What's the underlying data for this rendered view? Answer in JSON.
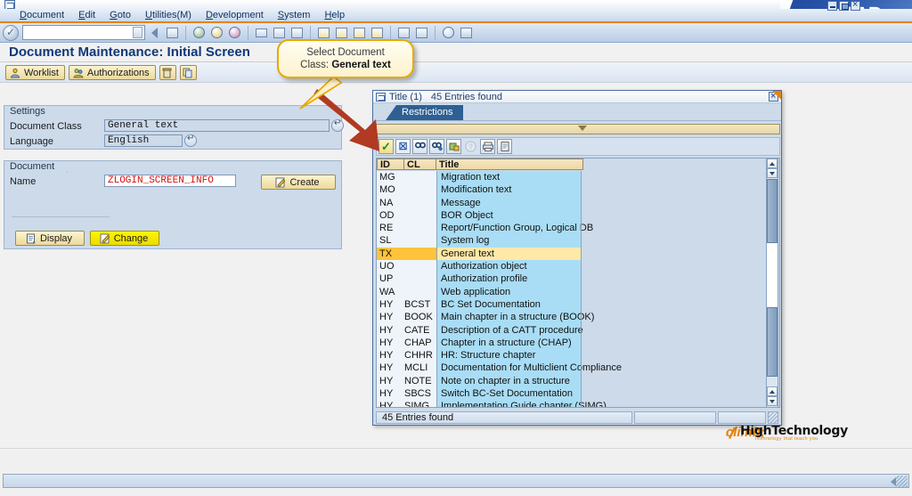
{
  "window": {
    "controls": [
      "minimize",
      "maximize",
      "close"
    ],
    "logo": "SAP"
  },
  "menubar": {
    "items": [
      {
        "label": "Document"
      },
      {
        "label": "Edit"
      },
      {
        "label": "Goto"
      },
      {
        "label": "Utilities(M)"
      },
      {
        "label": "Development"
      },
      {
        "label": "System"
      },
      {
        "label": "Help"
      }
    ]
  },
  "toolbar": {
    "command_value": "",
    "icons": [
      "enter-ok-icon",
      "back-icon",
      "save-icon",
      "back-green-icon",
      "exit-icon",
      "cancel-icon",
      "print-icon",
      "find-icon",
      "find-next-icon",
      "first-page-icon",
      "previous-page-icon",
      "next-page-icon",
      "last-page-icon",
      "new-session-icon",
      "create-shortcut-icon",
      "help-icon",
      "customize-icon"
    ]
  },
  "page": {
    "title": "Document Maintenance: Initial Screen"
  },
  "appbar": {
    "buttons": [
      {
        "label": "Worklist",
        "icon": "worklist-icon"
      },
      {
        "label": "Authorizations",
        "icon": "authorizations-icon"
      }
    ],
    "icon_buttons": [
      "delete-icon",
      "copy-icon"
    ]
  },
  "settings_panel": {
    "title": "Settings",
    "document_class_label": "Document Class",
    "document_class_value": "General text",
    "language_label": "Language",
    "language_value": "English"
  },
  "document_panel": {
    "title": "Document",
    "name_label": "Name",
    "name_value": "ZLOGIN_SCREEN_INFO",
    "create_button": "Create",
    "display_button": "Display",
    "change_button": "Change"
  },
  "callout": {
    "line1": "Select Document",
    "line2_prefix": "Class: ",
    "line2_bold": "General text"
  },
  "dialog": {
    "title": "Title (1)",
    "entries_found": "45 Entries found",
    "tab_label": "Restrictions",
    "toolbar_icons": [
      "copy-selection-icon",
      "cancel-icon",
      "find-icon",
      "find-next-icon",
      "personal-values-icon",
      "help-icon",
      "print-icon",
      "list-icon"
    ],
    "columns": [
      "ID",
      "CL",
      "Title"
    ],
    "status_text": "45 Entries found",
    "rows": [
      {
        "id": "MG",
        "cl": "",
        "title": "Migration text",
        "selected": false
      },
      {
        "id": "MO",
        "cl": "",
        "title": "Modification text",
        "selected": false
      },
      {
        "id": "NA",
        "cl": "",
        "title": "Message",
        "selected": false
      },
      {
        "id": "OD",
        "cl": "",
        "title": "BOR Object",
        "selected": false
      },
      {
        "id": "RE",
        "cl": "",
        "title": "Report/Function Group, Logical DB",
        "selected": false
      },
      {
        "id": "SL",
        "cl": "",
        "title": "System log",
        "selected": false
      },
      {
        "id": "TX",
        "cl": "",
        "title": "General text",
        "selected": true
      },
      {
        "id": "UO",
        "cl": "",
        "title": "Authorization object",
        "selected": false
      },
      {
        "id": "UP",
        "cl": "",
        "title": "Authorization profile",
        "selected": false
      },
      {
        "id": "WA",
        "cl": "",
        "title": "Web application",
        "selected": false
      },
      {
        "id": "HY",
        "cl": "BCST",
        "title": "BC Set Documentation",
        "selected": false
      },
      {
        "id": "HY",
        "cl": "BOOK",
        "title": "Main chapter in a structure (BOOK)",
        "selected": false
      },
      {
        "id": "HY",
        "cl": "CATE",
        "title": "Description of a CATT procedure",
        "selected": false
      },
      {
        "id": "HY",
        "cl": "CHAP",
        "title": "Chapter in a structure (CHAP)",
        "selected": false
      },
      {
        "id": "HY",
        "cl": "CHHR",
        "title": "HR: Structure chapter",
        "selected": false
      },
      {
        "id": "HY",
        "cl": "MCLI",
        "title": "Documentation for Multiclient Compliance",
        "selected": false
      },
      {
        "id": "HY",
        "cl": "NOTE",
        "title": "Note on chapter in a structure",
        "selected": false
      },
      {
        "id": "HY",
        "cl": "SBCS",
        "title": "Switch BC-Set Documentation",
        "selected": false
      },
      {
        "id": "HY",
        "cl": "SIMG",
        "title": "Implementation Guide chapter (SIMG)",
        "selected": false
      }
    ]
  },
  "watermark": {
    "name": "HighTechnology",
    "tagline": "Technology that teach you"
  },
  "colors": {
    "accent_orange": "#e98300",
    "title_blue": "#10387a",
    "list_blue": "#a9ddf5",
    "selection_amber": "#ffc33c",
    "button_gold": "#ecd99b",
    "change_yellow": "#f5e500",
    "red_text": "#d01010"
  }
}
